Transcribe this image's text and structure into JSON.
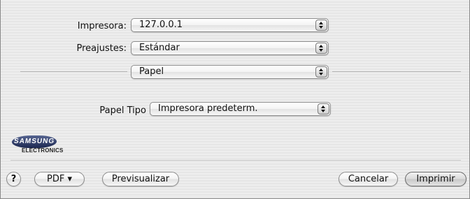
{
  "dialog": {
    "printer": {
      "label": "Impresora:",
      "value": "127.0.0.1"
    },
    "presets": {
      "label": "Preajustes:",
      "value": "Estándar"
    },
    "section": {
      "value": "Papel"
    },
    "paper_type": {
      "label": "Papel Tipo",
      "value": "Impresora predeterm."
    }
  },
  "logo": {
    "brand": "SAMSUNG",
    "sub": "ELECTRONICS"
  },
  "footer": {
    "help_label": "?",
    "pdf_label": "PDF ▾",
    "preview_label": "Previsualizar",
    "cancel_label": "Cancelar",
    "print_label": "Imprimir"
  },
  "colors": {
    "separator": "#b4b4b4",
    "logo_blue": "#1c2750"
  },
  "icons": [
    "popup-arrows-icon",
    "help-icon"
  ]
}
